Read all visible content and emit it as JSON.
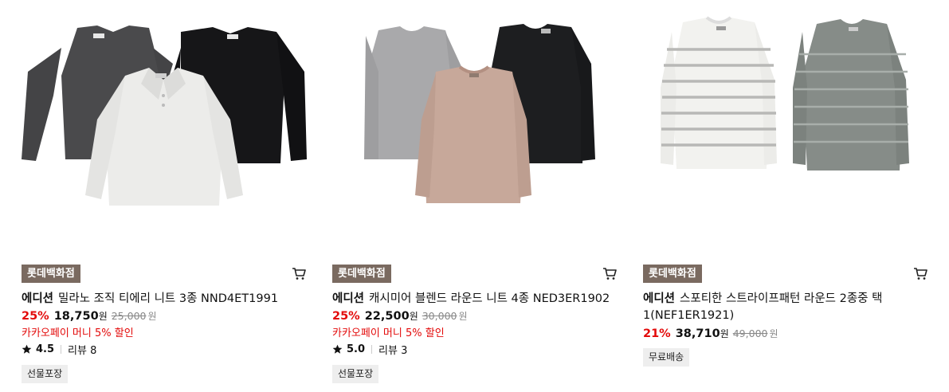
{
  "products": [
    {
      "store": "롯데백화점",
      "brand": "에디션",
      "name": "밀라노 조직 티에리 니트 3종 NND4ET1991",
      "discount": "25%",
      "price": "18,750",
      "price_unit": "원",
      "original_price": "25,000",
      "original_unit": "원",
      "promo": "카카오페이 머니 5% 할인",
      "rating": "4.5",
      "reviews": "리뷰 8",
      "tag": "선물포장",
      "icons": [
        "cart-icon",
        "star-icon"
      ]
    },
    {
      "store": "롯데백화점",
      "brand": "에디션",
      "name": "캐시미어 블렌드 라운드 니트 4종 NED3ER1902",
      "discount": "25%",
      "price": "22,500",
      "price_unit": "원",
      "original_price": "30,000",
      "original_unit": "원",
      "promo": "카카오페이 머니 5% 할인",
      "rating": "5.0",
      "reviews": "리뷰 3",
      "tag": "선물포장",
      "icons": [
        "cart-icon",
        "star-icon"
      ]
    },
    {
      "store": "롯데백화점",
      "brand": "에디션",
      "name": "스포티한 스트라이프패턴 라운드 2종중 택 1(NEF1ER1921)",
      "discount": "21%",
      "price": "38,710",
      "price_unit": "원",
      "original_price": "49,000",
      "original_unit": "원",
      "tag": "무료배송",
      "icons": [
        "cart-icon"
      ]
    }
  ],
  "colors": {
    "store_badge": "#7a6a60",
    "discount": "#e30a0a",
    "tag_bg": "#eeeeee"
  }
}
